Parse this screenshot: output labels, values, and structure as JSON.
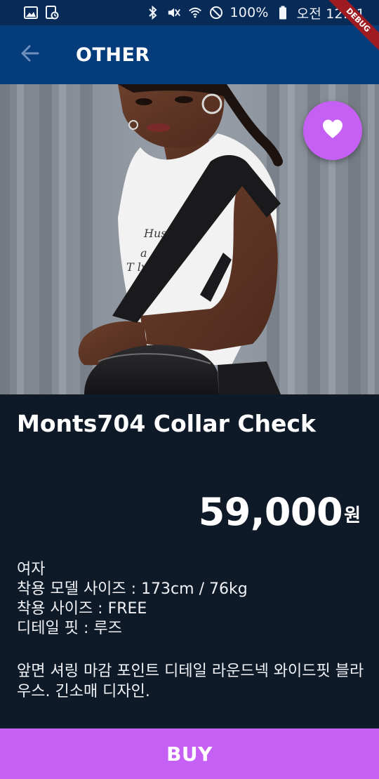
{
  "status_bar": {
    "battery_text": "100%",
    "time": "오전 12:21",
    "icons": [
      "gallery-icon",
      "screenshot-icon",
      "bluetooth-icon",
      "mute-icon",
      "wifi-icon",
      "no-disturb-icon",
      "battery-icon"
    ]
  },
  "debug_banner": "DEBUG",
  "app_bar": {
    "title": "OTHER",
    "back_icon": "arrow-back-icon"
  },
  "product": {
    "image_alt": "model wearing a white t-shirt with a black backpack",
    "favorite_icon": "heart-icon",
    "name": "Monts704 Collar Check",
    "price": "59,000",
    "currency": "원",
    "specs": [
      "여자",
      "착용 모델 사이즈 : 173cm / 76kg",
      "착용 사이즈 : FREE",
      "디테일 핏 : 루즈"
    ],
    "description": "앞면 셔링 마감 포인트 디테일 라운드넥 와이드핏 블라우스. 긴소매 디자인."
  },
  "buy_button": {
    "label": "BUY"
  },
  "colors": {
    "status_bar": "#072a57",
    "app_bar": "#053c7c",
    "background": "#0f1a29",
    "accent": "#c660f4",
    "debug": "#9e1b22"
  }
}
